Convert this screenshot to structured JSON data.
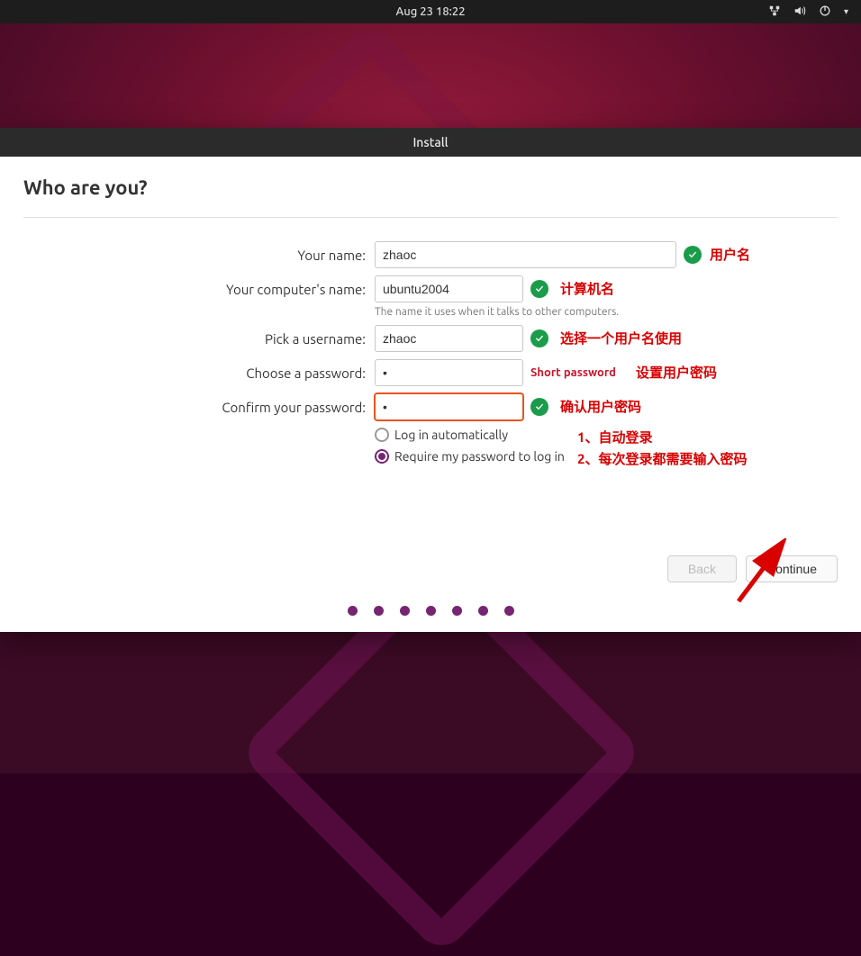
{
  "topbar": {
    "clock": "Aug 23  18:22"
  },
  "window": {
    "title": "Install",
    "heading": "Who are you?"
  },
  "form": {
    "name_label": "Your name:",
    "name_value": "zhaoc",
    "computer_label": "Your computer's name:",
    "computer_value": "ubuntu2004",
    "computer_hint": "The name it uses when it talks to other computers.",
    "username_label": "Pick a username:",
    "username_value": "zhaoc",
    "password_label": "Choose a password:",
    "password_value": "•",
    "password_warn": "Short password",
    "confirm_label": "Confirm your password:",
    "confirm_value": "•",
    "auto_login_label": "Log in automatically",
    "require_pw_label": "Require my password to log in"
  },
  "annotations": {
    "username": "用户名",
    "computer": "计算机名",
    "pick_user": "选择一个用户名使用",
    "set_password": "设置用户密码",
    "confirm_password": "确认用户密码",
    "auto_login": "1、自动登录",
    "require_pw": "2、每次登录都需要输入密码"
  },
  "buttons": {
    "back": "Back",
    "continue": "Continue"
  }
}
